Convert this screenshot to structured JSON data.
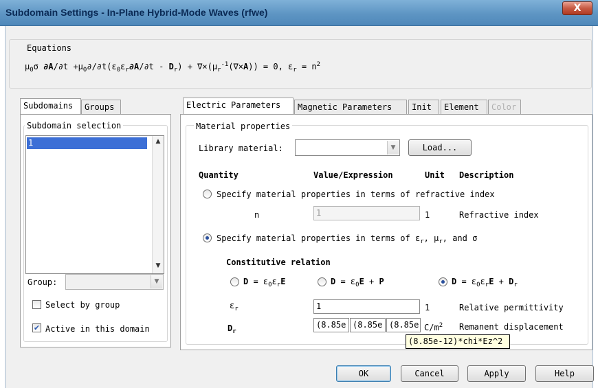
{
  "window": {
    "title": "Subdomain Settings - In-Plane Hybrid-Mode Waves (rfwe)",
    "close_glyph": "X"
  },
  "equations": {
    "label": "Equations",
    "p1": "μ",
    "p1s": "0",
    "p2": "σ ",
    "p3": "∂A",
    "p4": "/∂t +μ",
    "p4s": "0",
    "p5": "∂/∂t(ε",
    "p5s": "0",
    "p6": "ε",
    "p6s": "r",
    "p7": "∂A",
    "p8": "/∂t - ",
    "p9": "D",
    "p9s": "r",
    "p10": ") + ∇×(μ",
    "p10s": "r",
    "p10u": "-1",
    "p11": "(∇×",
    "p12": "A",
    "p13": ")) = 0,  ε",
    "p13s": "r",
    "p14": " = n",
    "p14u": "2"
  },
  "left_tabs": [
    {
      "label": "Subdomains",
      "active": true
    },
    {
      "label": "Groups",
      "active": false
    }
  ],
  "subdomain_selection": {
    "label": "Subdomain selection",
    "items": [
      "1"
    ],
    "selected": "1",
    "group_label": "Group:",
    "group_value": "",
    "select_by_group": {
      "label": "Select by group",
      "checked": false
    },
    "active_in_domain": {
      "label": "Active in this domain",
      "checked": true
    }
  },
  "right_tabs": [
    {
      "label": "Electric Parameters",
      "active": true,
      "disabled": false
    },
    {
      "label": "Magnetic Parameters",
      "active": false,
      "disabled": false
    },
    {
      "label": "Init",
      "active": false,
      "disabled": false
    },
    {
      "label": "Element",
      "active": false,
      "disabled": false
    },
    {
      "label": "Color",
      "active": false,
      "disabled": true
    }
  ],
  "material": {
    "group_label": "Material properties",
    "library_label": "Library material:",
    "library_value": "",
    "load_button": "Load..."
  },
  "headers": {
    "quantity": "Quantity",
    "value": "Value/Expression",
    "unit": "Unit",
    "description": "Description"
  },
  "options": {
    "refractive": {
      "label": "Specify material properties in terms of refractive index",
      "selected": false
    },
    "permittivity": {
      "label_a": "Specify material properties in terms of ε",
      "label_a_sub": "r",
      "label_b": ", μ",
      "label_b_sub": "r",
      "label_c": ", and σ",
      "selected": true
    }
  },
  "n_row": {
    "symbol": "n",
    "value": "1",
    "unit": "1",
    "description": "Refractive index"
  },
  "constitutive": {
    "title": "Constitutive relation",
    "r1": {
      "a": "D",
      "b": " = ε",
      "bs": "0",
      "c": "ε",
      "cs": "r",
      "d": "E",
      "selected": false
    },
    "r2": {
      "a": "D",
      "b": " = ε",
      "bs": "0",
      "c": "E",
      "d": " + ",
      "e": "P",
      "selected": false
    },
    "r3": {
      "a": "D",
      "b": " = ε",
      "bs": "0",
      "c": "ε",
      "cs": "r",
      "d": "E",
      "e": " + ",
      "f": "D",
      "fs": "r",
      "selected": true
    }
  },
  "eps_row": {
    "symbol": "ε",
    "symbol_sub": "r",
    "value": "1",
    "unit": "1",
    "description": "Relative permittivity"
  },
  "dr_row": {
    "symbol": "D",
    "symbol_sub": "r",
    "values": [
      "(8.85e",
      "(8.85e",
      "(8.85e"
    ],
    "unit": "C/m",
    "unit_sup": "2",
    "description": "Remanent displacement"
  },
  "tooltip": "(8.85e-12)*chi*Ez^2",
  "buttons": {
    "ok": "OK",
    "cancel": "Cancel",
    "apply": "Apply",
    "help": "Help"
  }
}
